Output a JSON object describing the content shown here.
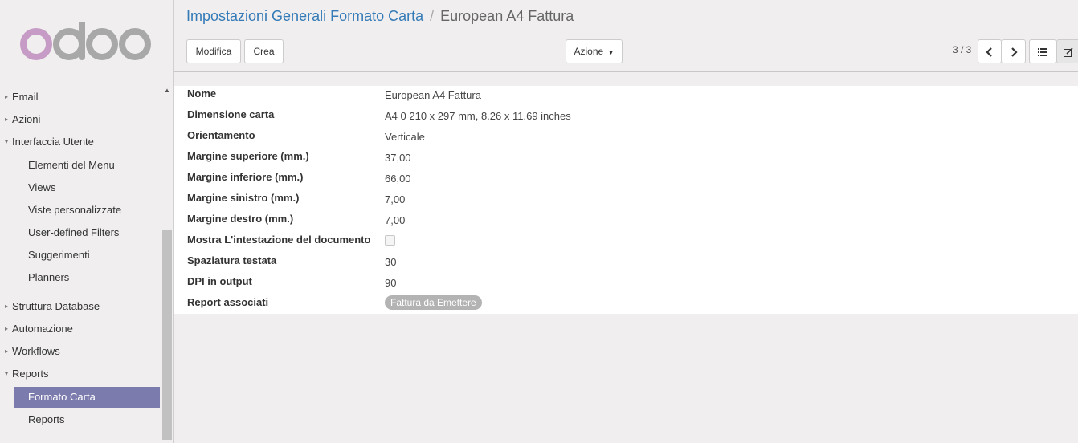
{
  "sidebar": {
    "logo_text": "odoo",
    "items": [
      {
        "label": "Email",
        "caret": "▸",
        "level": "top"
      },
      {
        "label": "Azioni",
        "caret": "▸",
        "level": "top"
      },
      {
        "label": "Interfaccia Utente",
        "caret": "▾",
        "level": "top"
      },
      {
        "label": "Elementi del Menu",
        "level": "sub"
      },
      {
        "label": "Views",
        "level": "sub"
      },
      {
        "label": "Viste personalizzate",
        "level": "sub"
      },
      {
        "label": "User-defined Filters",
        "level": "sub"
      },
      {
        "label": "Suggerimenti",
        "level": "sub"
      },
      {
        "label": "Planners",
        "level": "sub"
      },
      {
        "label": "Struttura Database",
        "caret": "▸",
        "level": "top"
      },
      {
        "label": "Automazione",
        "caret": "▸",
        "level": "top"
      },
      {
        "label": "Workflows",
        "caret": "▸",
        "level": "top"
      },
      {
        "label": "Reports",
        "caret": "▾",
        "level": "top"
      },
      {
        "label": "Formato Carta",
        "level": "sub",
        "active": true
      },
      {
        "label": "Reports",
        "level": "sub"
      }
    ]
  },
  "breadcrumb": {
    "parent": "Impostazioni Generali Formato Carta",
    "separator": "/",
    "current": "European A4 Fattura"
  },
  "toolbar": {
    "edit_label": "Modifica",
    "create_label": "Crea",
    "action_label": "Azione"
  },
  "pager": {
    "value": "3 / 3"
  },
  "form": {
    "fields": [
      {
        "label": "Nome",
        "value": "European A4 Fattura"
      },
      {
        "label": "Dimensione carta",
        "value": "A4 0 210 x 297 mm, 8.26 x 11.69 inches"
      },
      {
        "label": "Orientamento",
        "value": "Verticale"
      },
      {
        "label": "Margine superiore (mm.)",
        "value": "37,00"
      },
      {
        "label": "Margine inferiore (mm.)",
        "value": "66,00"
      },
      {
        "label": "Margine sinistro (mm.)",
        "value": "7,00"
      },
      {
        "label": "Margine destro (mm.)",
        "value": "7,00"
      },
      {
        "label": "Mostra L'intestazione del documento",
        "checkbox_checked": false
      },
      {
        "label": "Spaziatura testata",
        "value": "30"
      },
      {
        "label": "DPI in output",
        "value": "90"
      },
      {
        "label": "Report associati",
        "tag": "Fattura da Emettere"
      }
    ]
  },
  "colors": {
    "active_menu": "#7c7bad",
    "link": "#337ab7",
    "tag": "#b3b3b3",
    "logo_o": "#c7a0c7",
    "logo_letters": "#a9a9a9"
  }
}
